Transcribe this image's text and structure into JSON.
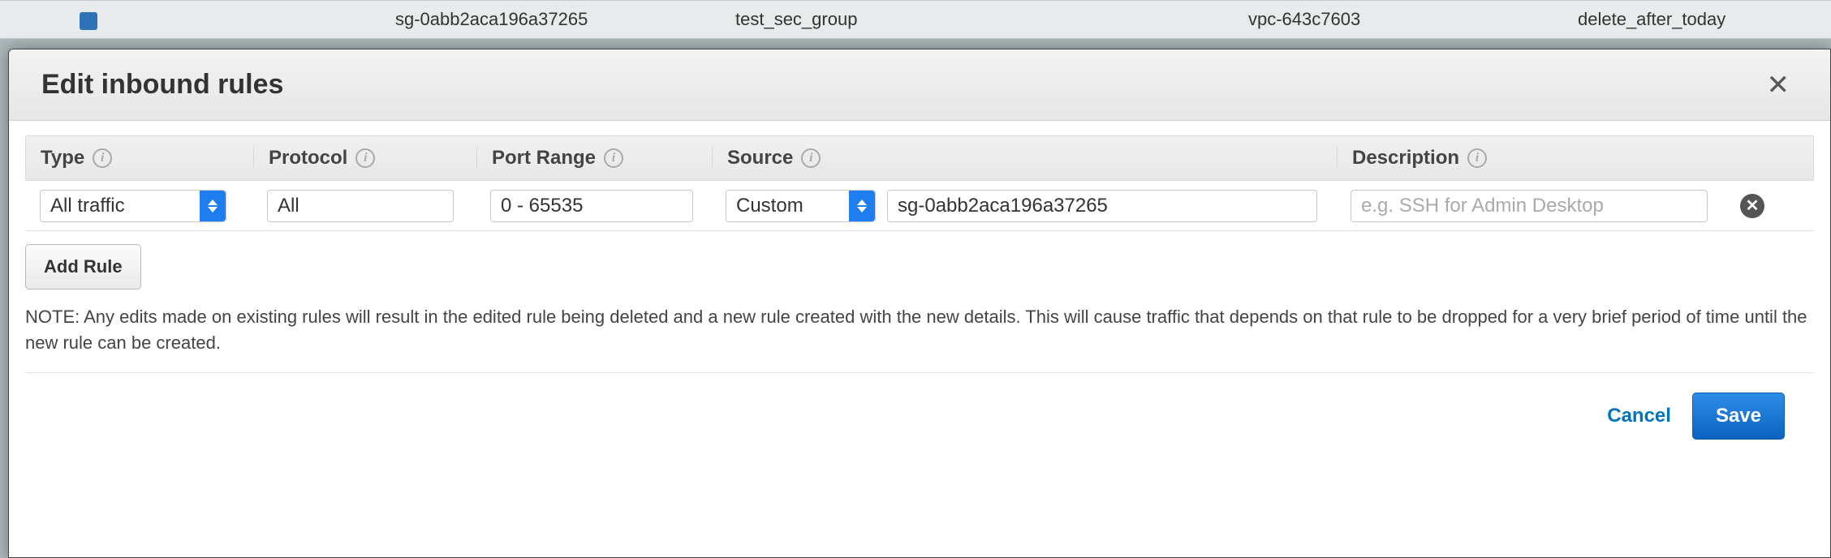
{
  "background_row": {
    "security_group_id": "sg-0abb2aca196a37265",
    "name": "test_sec_group",
    "vpc_id": "vpc-643c7603",
    "description": "delete_after_today"
  },
  "modal": {
    "title": "Edit inbound rules",
    "columns": {
      "type": "Type",
      "protocol": "Protocol",
      "port_range": "Port Range",
      "source": "Source",
      "description": "Description"
    },
    "rule": {
      "type": "All traffic",
      "protocol": "All",
      "port_range": "0 - 65535",
      "source_mode": "Custom",
      "source_value": "sg-0abb2aca196a37265",
      "description_placeholder": "e.g. SSH for Admin Desktop"
    },
    "add_rule_label": "Add Rule",
    "note": "NOTE: Any edits made on existing rules will result in the edited rule being deleted and a new rule created with the new details. This will cause traffic that depends on that rule to be dropped for a very brief period of time until the new rule can be created.",
    "cancel_label": "Cancel",
    "save_label": "Save"
  }
}
